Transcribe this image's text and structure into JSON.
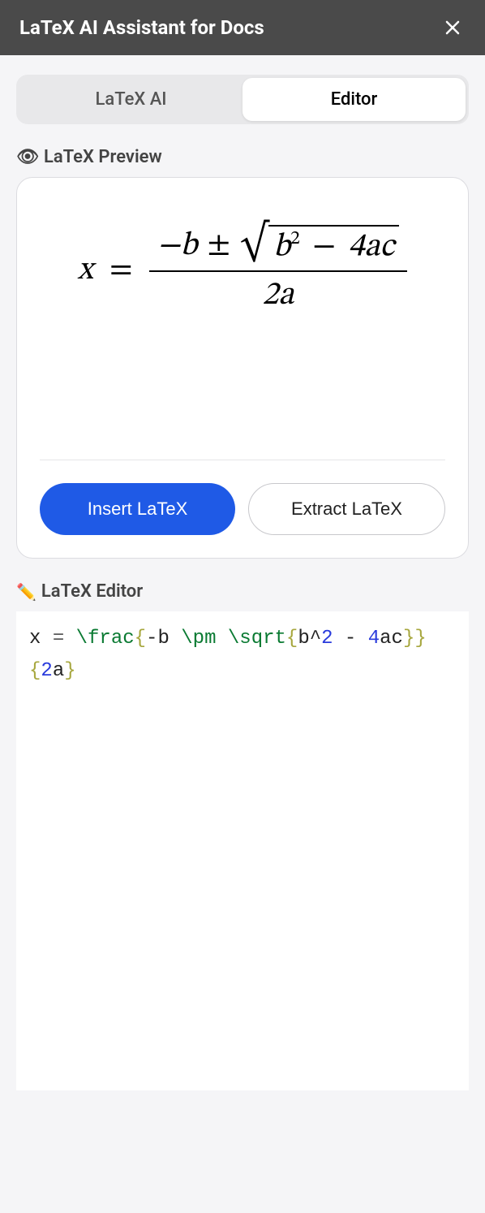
{
  "header": {
    "title": "LaTeX AI Assistant for Docs"
  },
  "tabs": {
    "latex_ai": "LaTeX AI",
    "editor": "Editor",
    "active": "editor"
  },
  "preview": {
    "label": "LaTeX Preview",
    "icon": "👁",
    "formula": {
      "lhs": "x",
      "numerator_prefix": "−b",
      "pm": "±",
      "sqrt_inner_b": "b",
      "sqrt_inner_exp": "2",
      "sqrt_inner_minus": "−",
      "sqrt_inner_4ac": "4ac",
      "denominator": "2a"
    },
    "buttons": {
      "insert": "Insert LaTeX",
      "extract": "Extract LaTeX"
    }
  },
  "editor": {
    "label": "LaTeX Editor",
    "icon": "✏️",
    "tokens": [
      {
        "t": "x ",
        "c": "plain"
      },
      {
        "t": "= ",
        "c": "op"
      },
      {
        "t": "\\frac",
        "c": "cmd"
      },
      {
        "t": "{",
        "c": "brace"
      },
      {
        "t": "-b ",
        "c": "plain"
      },
      {
        "t": "\\pm",
        "c": "cmd"
      },
      {
        "t": " ",
        "c": "plain"
      },
      {
        "t": "\\sqrt",
        "c": "cmd"
      },
      {
        "t": "{",
        "c": "brace"
      },
      {
        "t": "b^",
        "c": "plain"
      },
      {
        "t": "2",
        "c": "num"
      },
      {
        "t": " - ",
        "c": "plain"
      },
      {
        "t": "4",
        "c": "num"
      },
      {
        "t": "ac",
        "c": "plain"
      },
      {
        "t": "}",
        "c": "brace"
      },
      {
        "t": "}",
        "c": "brace"
      },
      {
        "t": "\n",
        "c": "plain"
      },
      {
        "t": "{",
        "c": "brace"
      },
      {
        "t": "2",
        "c": "num"
      },
      {
        "t": "a",
        "c": "plain"
      },
      {
        "t": "}",
        "c": "brace"
      }
    ]
  }
}
